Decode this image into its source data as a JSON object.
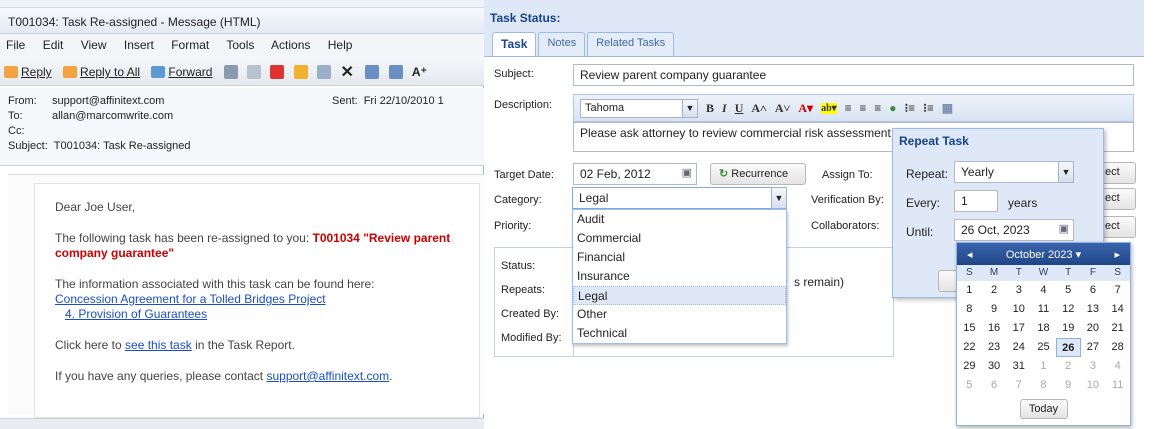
{
  "email": {
    "window_title": "T001034: Task Re-assigned - Message (HTML)",
    "menu": [
      "File",
      "Edit",
      "View",
      "Insert",
      "Format",
      "Tools",
      "Actions",
      "Help"
    ],
    "toolbar": {
      "reply": "Reply",
      "reply_all": "Reply to All",
      "forward": "Forward"
    },
    "headers": {
      "from_label": "From:",
      "from": "support@affinitext.com",
      "sent_label": "Sent:",
      "sent": "Fri 22/10/2010 1",
      "to_label": "To:",
      "to": "allan@marcomwrite.com",
      "cc_label": "Cc:",
      "subject_label": "Subject:",
      "subject": "T001034: Task Re-assigned"
    },
    "body": {
      "greeting": "Dear Joe User,",
      "line1": "The following task has been re-assigned to you: ",
      "task_ref": "T001034 \"Review parent company guarantee\"",
      "line2": "The information associated with this task can be found here:",
      "link1": "Concession Agreement for a Tolled Bridges Project",
      "link2": "4. Provision of Guarantees",
      "click_pre": "Click here to ",
      "click_link": "see this task",
      "click_post": " in the Task Report.",
      "query_pre": "If you have any queries, please contact ",
      "query_link": "support@affinitext.com",
      "query_post": "."
    }
  },
  "task": {
    "panel_title": "Task Status:",
    "tabs": [
      "Task",
      "Notes",
      "Related Tasks"
    ],
    "subject_label": "Subject:",
    "subject": "Review parent company guarantee",
    "description_label": "Description:",
    "font": "Tahoma",
    "description": "Please ask attorney to review commercial risk assessment",
    "target_date_label": "Target Date:",
    "target_date": "02 Feb, 2012",
    "recurrence_button": "Recurrence",
    "assign_to_label": "Assign To:",
    "category_label": "Category:",
    "category": "Legal",
    "verification_label": "Verification By:",
    "priority_label": "Priority:",
    "collaborators_label": "Collaborators:",
    "select_btn": "ect",
    "category_options": [
      "Audit",
      "Commercial",
      "Financial",
      "Insurance",
      "Legal",
      "Other",
      "Technical"
    ],
    "status_labels": [
      "Status:",
      "Repeats:",
      "Created By:",
      "Modified By:"
    ],
    "remain_text": "s remain)"
  },
  "repeat": {
    "title": "Repeat Task",
    "repeat_label": "Repeat:",
    "repeat_value": "Yearly",
    "every_label": "Every:",
    "every_value": "1",
    "every_unit": "years",
    "until_label": "Until:",
    "until_value": "26 Oct, 2023"
  },
  "calendar": {
    "month": "October 2023",
    "dow": [
      "S",
      "M",
      "T",
      "W",
      "T",
      "F",
      "S"
    ],
    "weeks": [
      [
        "1",
        "2",
        "3",
        "4",
        "5",
        "6",
        "7"
      ],
      [
        "8",
        "9",
        "10",
        "11",
        "12",
        "13",
        "14"
      ],
      [
        "15",
        "16",
        "17",
        "18",
        "19",
        "20",
        "21"
      ],
      [
        "22",
        "23",
        "24",
        "25",
        "26",
        "27",
        "28"
      ],
      [
        "29",
        "30",
        "31",
        "1",
        "2",
        "3",
        "4"
      ],
      [
        "5",
        "6",
        "7",
        "8",
        "9",
        "10",
        "11"
      ]
    ],
    "today_button": "Today"
  }
}
